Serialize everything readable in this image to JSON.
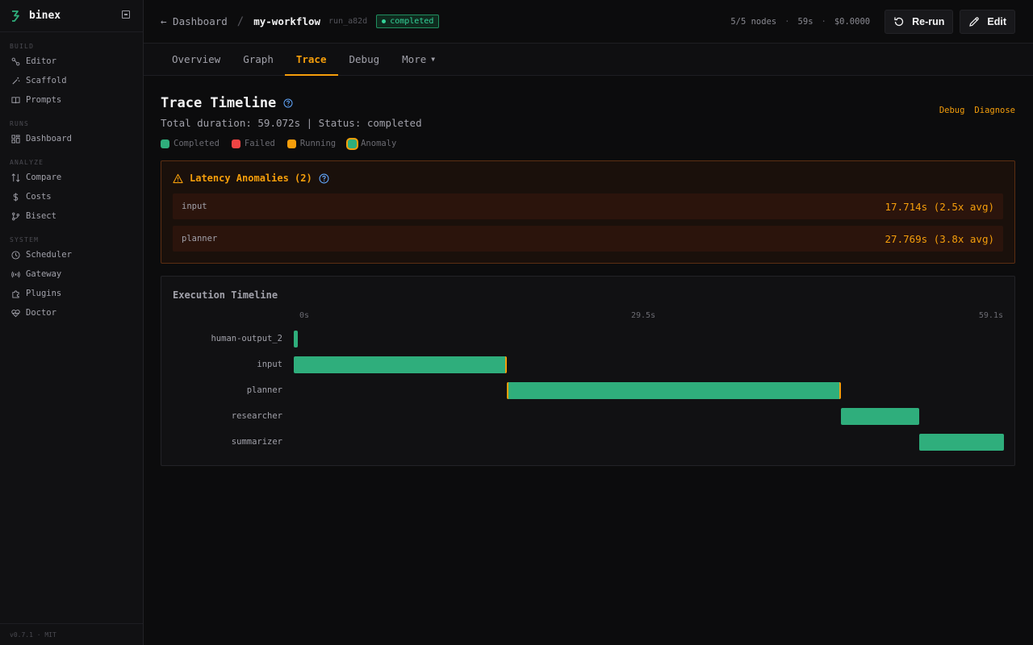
{
  "sidebar": {
    "brand": "binex",
    "sections": [
      {
        "label": "BUILD",
        "items": [
          {
            "label": "Editor",
            "icon": "route-icon"
          },
          {
            "label": "Scaffold",
            "icon": "wand-icon"
          },
          {
            "label": "Prompts",
            "icon": "book-icon"
          }
        ]
      },
      {
        "label": "RUNS",
        "items": [
          {
            "label": "Dashboard",
            "icon": "layout-icon"
          }
        ]
      },
      {
        "label": "ANALYZE",
        "items": [
          {
            "label": "Compare",
            "icon": "compare-icon"
          },
          {
            "label": "Costs",
            "icon": "dollar-icon"
          },
          {
            "label": "Bisect",
            "icon": "git-branch-icon"
          }
        ]
      },
      {
        "label": "SYSTEM",
        "items": [
          {
            "label": "Scheduler",
            "icon": "clock-icon"
          },
          {
            "label": "Gateway",
            "icon": "radio-icon"
          },
          {
            "label": "Plugins",
            "icon": "puzzle-icon"
          },
          {
            "label": "Doctor",
            "icon": "heart-pulse-icon"
          }
        ]
      }
    ],
    "footer": "v0.7.1 · MIT"
  },
  "header": {
    "back_label": "← Dashboard",
    "separator": "/",
    "workflow_name": "my-workflow",
    "run_id": "run_a82d",
    "status": "completed",
    "nodes": "5/5 nodes",
    "duration": "59s",
    "cost": "$0.0000",
    "rerun_label": "Re-run",
    "edit_label": "Edit"
  },
  "tabs": [
    {
      "label": "Overview",
      "active": false
    },
    {
      "label": "Graph",
      "active": false
    },
    {
      "label": "Trace",
      "active": true
    },
    {
      "label": "Debug",
      "active": false
    },
    {
      "label": "More",
      "active": false
    }
  ],
  "trace": {
    "title": "Trace Timeline",
    "subtitle": "Total duration: 59.072s | Status: completed",
    "actions": {
      "debug": "Debug",
      "diagnose": "Diagnose"
    },
    "legend": [
      {
        "label": "Completed",
        "color": "#2fae7c"
      },
      {
        "label": "Failed",
        "color": "#ef4444"
      },
      {
        "label": "Running",
        "color": "#f59e0b"
      },
      {
        "label": "Anomaly",
        "color": "#2fae7c",
        "outline": "#f59e0b"
      }
    ]
  },
  "anomalies": {
    "title": "Latency Anomalies (2)",
    "items": [
      {
        "name": "input",
        "value": "17.714s (2.5x avg)"
      },
      {
        "name": "planner",
        "value": "27.769s (3.8x avg)"
      }
    ]
  },
  "timeline": {
    "title": "Execution Timeline",
    "axis_labels": [
      "0s",
      "29.5s",
      "59.1s"
    ],
    "total_seconds": 59.072
  },
  "chart_data": {
    "type": "bar",
    "title": "Execution Timeline",
    "xlim": [
      0,
      59.072
    ],
    "x_tick_labels": [
      "0s",
      "29.5s",
      "59.1s"
    ],
    "series": [
      {
        "name": "human-output_2",
        "start": 0.0,
        "end": 0.35,
        "status": "completed",
        "anomaly": false
      },
      {
        "name": "input",
        "start": 0.0,
        "end": 17.714,
        "status": "completed",
        "anomaly": true
      },
      {
        "name": "planner",
        "start": 17.714,
        "end": 45.483,
        "status": "completed",
        "anomaly": true
      },
      {
        "name": "researcher",
        "start": 45.483,
        "end": 52.0,
        "status": "completed",
        "anomaly": false
      },
      {
        "name": "summarizer",
        "start": 52.0,
        "end": 59.072,
        "status": "completed",
        "anomaly": false
      }
    ]
  }
}
